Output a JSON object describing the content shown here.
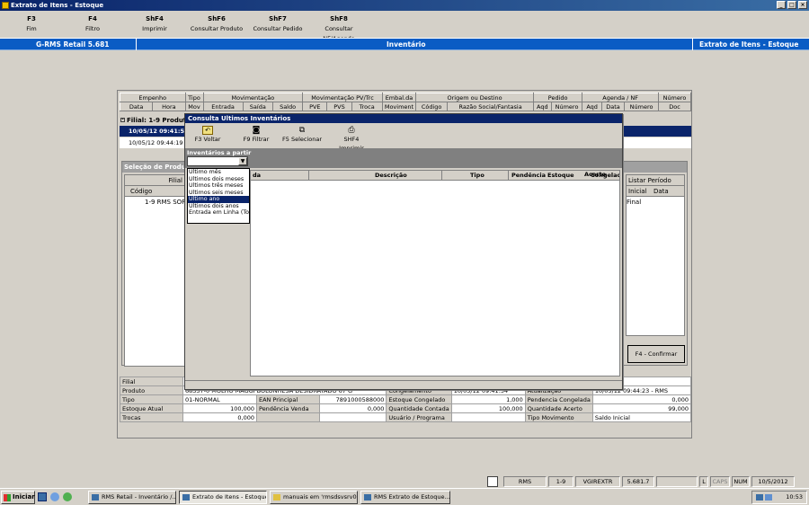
{
  "window": {
    "title": "Extrato de Itens - Estoque",
    "controls": [
      "_",
      "□",
      "×"
    ]
  },
  "fkeys": [
    {
      "key": "F3",
      "label": "Fim"
    },
    {
      "key": "F4",
      "label": "Filtro"
    },
    {
      "key": "ShF4",
      "label": "Imprimir"
    },
    {
      "key": "ShF6",
      "label": "Consultar Produto"
    },
    {
      "key": "ShF7",
      "label": "Consultar Pedido"
    },
    {
      "key": "ShF8",
      "label": "Consultar NF/Agenda"
    }
  ],
  "bluebar": {
    "left": "G-RMS Retail 5.681",
    "center": "Inventário",
    "right": "Extrato de Itens - Estoque"
  },
  "main": {
    "group_headers": [
      "Empenho",
      "Tipo",
      "Movimentação",
      "Movimentação PV/Trc",
      "Embal.da",
      "Origem ou Destino",
      "Pedido",
      "Agenda / NF",
      "Número"
    ],
    "sub_headers": [
      "Data",
      "Hora",
      "Mov",
      "Entrada",
      "Saída",
      "Saldo",
      "PVE",
      "PVS",
      "Troca",
      "Moviment",
      "Código",
      "Razão Social/Fantasia",
      "Aqd",
      "Número",
      "Aqd",
      "Data",
      "Número",
      "Doc"
    ],
    "filial_label": "Filial: 1-9 Produto:",
    "rows": [
      {
        "data": "10/05/12",
        "hora": "09:41:54"
      },
      {
        "data": "10/05/12",
        "hora": "09:44:19"
      }
    ],
    "selecao_title": "Seleção de Produto",
    "selecao_filial": "Filial",
    "selecao_codigo": "Código",
    "selecao_row": "1-9  RMS SOFT",
    "listar": "Listar Período",
    "inicial": "Inicial",
    "data_final": "Data Final",
    "confirm_button": "F4 - Confirmar"
  },
  "info": {
    "filial_label": "Filial",
    "produto_label": "Produto",
    "produto_value": "68337-0 MOLHO MAGGI BOLONHESA DESIDRATADO 67 G",
    "tipo_label": "Tipo",
    "tipo_value": "01-NORMAL",
    "ean_label": "EAN Principal",
    "ean_value": "7891000588000",
    "estoque_atual_label": "Estoque Atual",
    "estoque_atual_value": "100,000",
    "pend_venda_label": "Pendência Venda",
    "pend_venda_value": "0,000",
    "trocas_label": "Trocas",
    "trocas_value": "0,000",
    "congelamento_label": "Congelamento",
    "congelamento_value": "10/05/12 09:41:54",
    "atualizacao_label": "Atualização",
    "atualizacao_value": "10/05/12 09:44:23 - RMS",
    "est_congelado_label": "Estoque Congelado",
    "est_congelado_value": "1,000",
    "pend_congelada_label": "Pendencia Congelada",
    "pend_congelada_value": "0,000",
    "qtd_contada_label": "Quantidade Contada",
    "qtd_contada_value": "100,000",
    "qtd_acerto_label": "Quantidade Acerto",
    "qtd_acerto_value": "99,000",
    "usuario_label": "Usuário / Programa",
    "tipo_mov_label": "Tipo Movimento",
    "tipo_mov_value": "Saldo Inicial"
  },
  "dialog": {
    "title": "Consulta Ultimos Inventários",
    "toolbar": [
      {
        "label": "F3 Voltar",
        "icon": "back-icon"
      },
      {
        "label": "F9 Filtrar",
        "icon": "binoculars-icon"
      },
      {
        "label": "F5 Selecionar",
        "icon": "select-icon"
      },
      {
        "label": "SHF4 Imprimir",
        "icon": "printer-icon"
      }
    ],
    "dropdown_label": "Inventários a partir",
    "options": [
      "Último mês",
      "Últimos dois meses",
      "Últimos três meses",
      "Últimos seis meses",
      "Último ano",
      "Últimos dois anos",
      "Entrada em Linha (Todos)"
    ],
    "selected_index": 4,
    "col_partial": "da",
    "columns": [
      "Descrição",
      "Tipo",
      "Pendência",
      "Estoque",
      "Congelado",
      "Acerto"
    ]
  },
  "status": {
    "rms": "RMS",
    "filial": "1-9",
    "prog": "VGIREXTR",
    "version": "5.681.7",
    "l": "L",
    "caps": "CAPS",
    "num": "NUM",
    "date": "10/5/2012"
  },
  "taskbar": {
    "start": "Iniciar",
    "tasks": [
      "RMS Retail - Inventário /...",
      "Extrato de Itens - Estoque",
      "manuais em 'rmsdsvsrv0...",
      "RMS Extrato de Estoque..."
    ],
    "clock": "10:53"
  }
}
